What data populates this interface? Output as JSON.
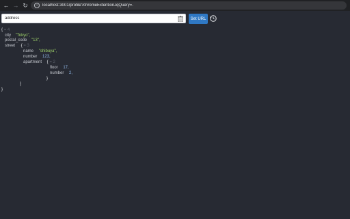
{
  "browser": {
    "url": "localhost:3001/profile?chromeExtentionJqQuery=."
  },
  "toolbar": {
    "path_value": "address",
    "set_url_label": "Set URL"
  },
  "json_view": {
    "root_open": "{",
    "root_count": "= 4",
    "city_key": "city",
    "city_value": "\"Tokyo\",",
    "postal_key": "postal_code",
    "postal_value": "\"13\",",
    "street_key": "street",
    "street_open": "{",
    "street_count": "= 3",
    "name_key": "name",
    "name_value": "\"shibuya\",",
    "number_key": "number",
    "number_value": "123,",
    "apartment_key": "apartment",
    "apartment_open": "{",
    "apartment_count": "= 2",
    "floor_key": "floor",
    "floor_value": "17,",
    "apt_number_key": "number",
    "apt_number_value": "2,",
    "apartment_close": "}",
    "street_close": "}",
    "root_close": "}"
  }
}
